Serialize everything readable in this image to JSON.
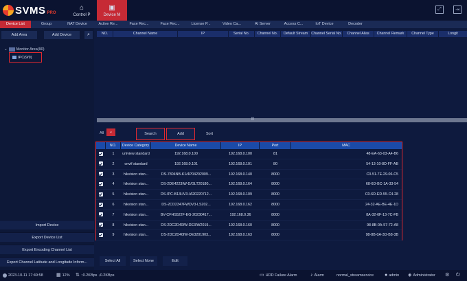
{
  "app": {
    "logo": "SVMS",
    "logo_suffix": "PRO"
  },
  "nav": {
    "tabs": [
      {
        "label": "Control P",
        "icon": "home-icon"
      },
      {
        "label": "Device M",
        "icon": "device-manager-icon"
      }
    ]
  },
  "window_controls": {
    "restore": "⤢",
    "exit": "⇥"
  },
  "subtabs": [
    "Device List",
    "Group",
    "NAT Device",
    "Active Re...",
    "Face Rec...",
    "Face Rec...",
    "License P...",
    "Video Ca...",
    "AI Server",
    "Access C...",
    "IoT Device",
    "Decoder"
  ],
  "left_panel": {
    "add_area": "Add Area",
    "add_device": "Add Device",
    "search_icon": "⌕",
    "tree_root": "Monitor Area(90)",
    "tree_child": "IPC(9/9)",
    "bottom_buttons": [
      "Import Device",
      "Export Device List",
      "Export Encoding Channel List",
      "Export Channel Latitude and Longitude Inform..."
    ]
  },
  "channel_table": {
    "columns": [
      "NO.",
      "Channel Name",
      "IP",
      "Serial No.",
      "Channel No.",
      "Default Stream",
      "Channel Serial No.",
      "Channel Alias",
      "Channel Remark",
      "Channel Type",
      "Longit"
    ]
  },
  "scroll_handle": "|||",
  "toolbar": {
    "filter_value": "All",
    "dropdown_arrow": "⌄",
    "search": "Search",
    "add": "Add",
    "sort": "Sort"
  },
  "device_table": {
    "columns": [
      "",
      "NO.",
      "Device Category",
      "Device Name",
      "IP",
      "Port",
      "MAC"
    ],
    "rows": [
      {
        "no": "1",
        "category": "uniview standard",
        "name": "192.168.0.100",
        "ip": "192.168.0.100",
        "port": "81",
        "mac": "48-EA-63-03-A4-B6"
      },
      {
        "no": "2",
        "category": "onvif standard",
        "name": "192.168.0.101",
        "ip": "192.168.0.101",
        "port": "80",
        "mac": "54-13-10-8D-FF-AB"
      },
      {
        "no": "3",
        "category": "hikvision stan...",
        "name": "DS-7804NB-K1/4P04202009...",
        "ip": "192.168.0.140",
        "port": "8000",
        "mac": "C0-51-7E-29-06-C5"
      },
      {
        "no": "4",
        "category": "hikvision stan...",
        "name": "DS-2DE4223IW-D/GLT20180...",
        "ip": "192.168.0.164",
        "port": "8000",
        "mac": "68-6D-BC-1A-33-54"
      },
      {
        "no": "5",
        "category": "hikvision stan...",
        "name": "DS-IPC-B13HV3-IA20220712...",
        "ip": "192.168.0.109",
        "port": "8000",
        "mac": "C0-6D-ED-55-C4-28"
      },
      {
        "no": "6",
        "category": "hikvision stan...",
        "name": "DS-2CD2347FWDV3-LS202...",
        "ip": "192.168.0.162",
        "port": "8000",
        "mac": "24-32-AE-BE-4E-1D"
      },
      {
        "no": "7",
        "category": "hikvision stan...",
        "name": "BV-CFHS522F-EG-20230417...",
        "ip": "192.168.0.36",
        "port": "8000",
        "mac": "8A-32-6F-13-7C-FB"
      },
      {
        "no": "8",
        "category": "hikvision stan...",
        "name": "DS-2DC2D40IW-DE3/W2019...",
        "ip": "192.168.0.160",
        "port": "8000",
        "mac": "98-8B-0A-57-72-A8"
      },
      {
        "no": "9",
        "category": "hikvision stan...",
        "name": "DS-2DC2D40IW-DE3201903...",
        "ip": "192.168.0.163",
        "port": "8000",
        "mac": "98-8B-0A-3D-B8-3B"
      }
    ]
  },
  "bottom_actions": {
    "select_all": "Select All",
    "select_none": "Select None",
    "edit": "Edit"
  },
  "status": {
    "datetime": "2023-10-11 17:49:58",
    "cpu": "12%",
    "net": "↑0.2KBps ↓0.2KBps",
    "hdd": "HDD Failure Alarm",
    "alarm": "Alarm",
    "service": "normal_streamservice",
    "user": "admin",
    "role": "Administrator"
  }
}
